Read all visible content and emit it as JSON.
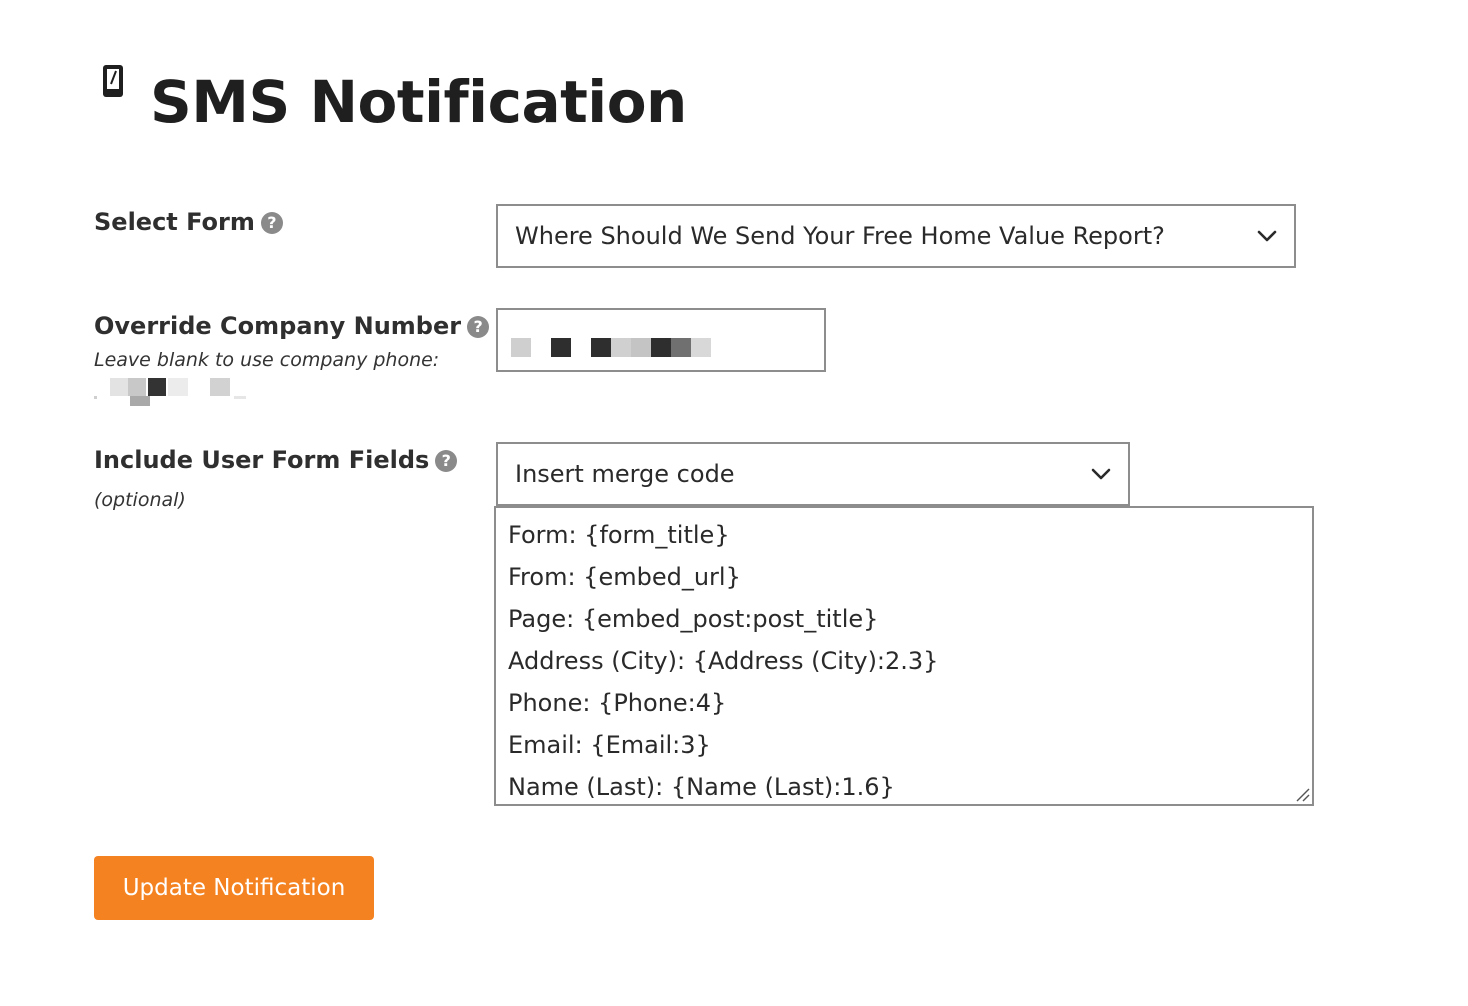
{
  "header": {
    "icon": "mobile-phone-icon",
    "title": "SMS Notification"
  },
  "select_form": {
    "label": "Select Form",
    "help_icon": "?",
    "value": "Where Should We Send Your Free Home Value Report?"
  },
  "override_number": {
    "label": "Override Company Number",
    "help_icon": "?",
    "hint": "Leave blank to use company phone:",
    "value_state": "redacted (pixelated)",
    "company_phone_state": "redacted (pixelated)"
  },
  "user_fields": {
    "label": "Include User Form Fields",
    "help_icon": "?",
    "hint": "(optional)",
    "merge_select_value": "Insert merge code",
    "message_lines": [
      "Form: {form_title}",
      "From: {embed_url}",
      "Page: {embed_post:post_title}",
      "Address (City): {Address (City):2.3}",
      "Phone: {Phone:4}",
      "Email: {Email:3}",
      "Name (Last): {Name (Last):1.6}"
    ]
  },
  "actions": {
    "update_label": "Update Notification"
  },
  "colors": {
    "accent": "#f58220",
    "border": "#8d8d8d",
    "help_icon": "#8a8a8a",
    "text": "#2b2b2b"
  }
}
